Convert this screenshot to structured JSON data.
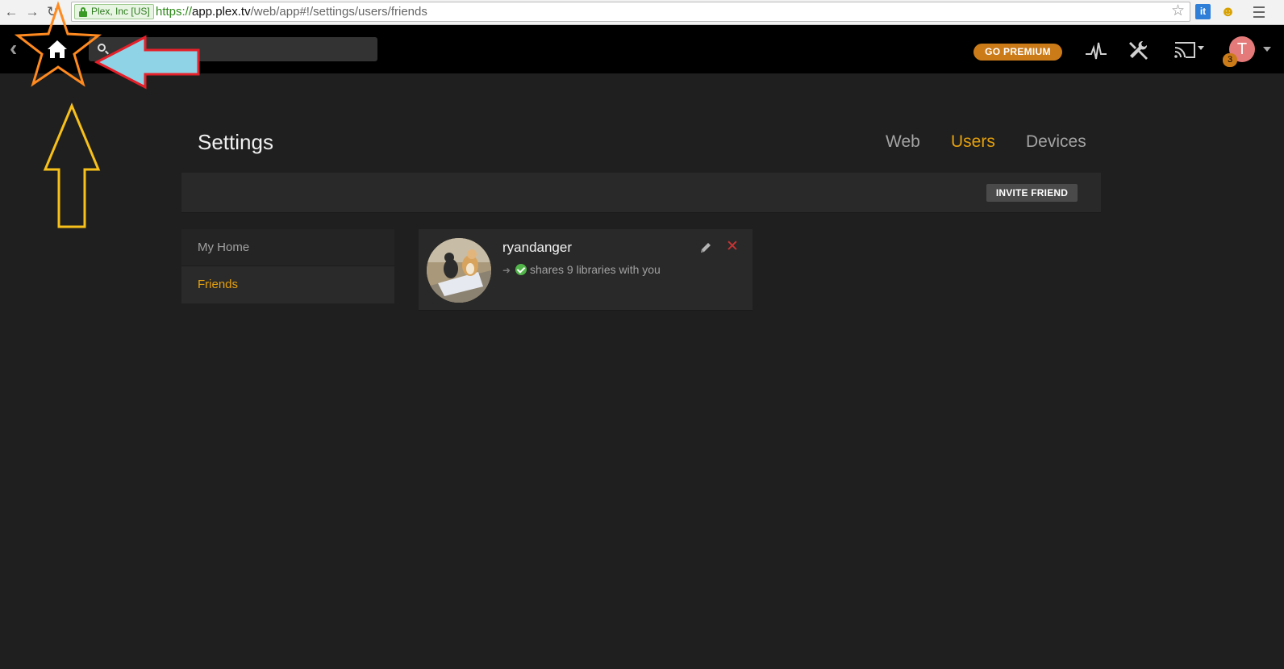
{
  "browser": {
    "secure_label": "Plex, Inc [US]",
    "url_scheme": "https://",
    "url_host": "app.plex.tv",
    "url_path": "/web/app#!/settings/users/friends",
    "extension_label": "it"
  },
  "topbar": {
    "search_placeholder": "",
    "premium_label": "GO PREMIUM",
    "avatar_initial": "T",
    "notification_count": "3",
    "accent_color": "#e5a00d"
  },
  "settings": {
    "title": "Settings",
    "tabs": [
      {
        "label": "Web",
        "active": false
      },
      {
        "label": "Users",
        "active": true
      },
      {
        "label": "Devices",
        "active": false
      }
    ],
    "invite_label": "INVITE FRIEND",
    "side_menu": [
      {
        "label": "My Home",
        "active": false
      },
      {
        "label": "Friends",
        "active": true
      }
    ]
  },
  "friends": [
    {
      "name": "ryandanger",
      "share_text": "shares 9 libraries with you"
    }
  ]
}
